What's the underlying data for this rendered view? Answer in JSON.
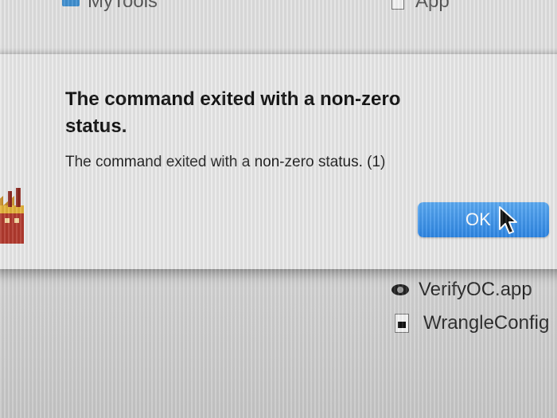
{
  "background_window": {
    "items_top": [
      {
        "label": "MyTools",
        "icon": "folder-icon"
      },
      {
        "label": "App",
        "icon": "document-icon"
      }
    ],
    "items_bottom": [
      {
        "label": "VerifyOC.app",
        "icon": "eye-app-icon"
      },
      {
        "label": "WrangleConfig",
        "icon": "document-icon"
      }
    ]
  },
  "alert": {
    "app_icon": "factory-app-icon",
    "title": "The command exited with a non-zero status.",
    "message": "The command exited with a non-zero status. (1)",
    "ok_label": "OK",
    "accent_color": "#2d86e4"
  },
  "cursor": {
    "icon": "mouse-pointer-icon"
  }
}
